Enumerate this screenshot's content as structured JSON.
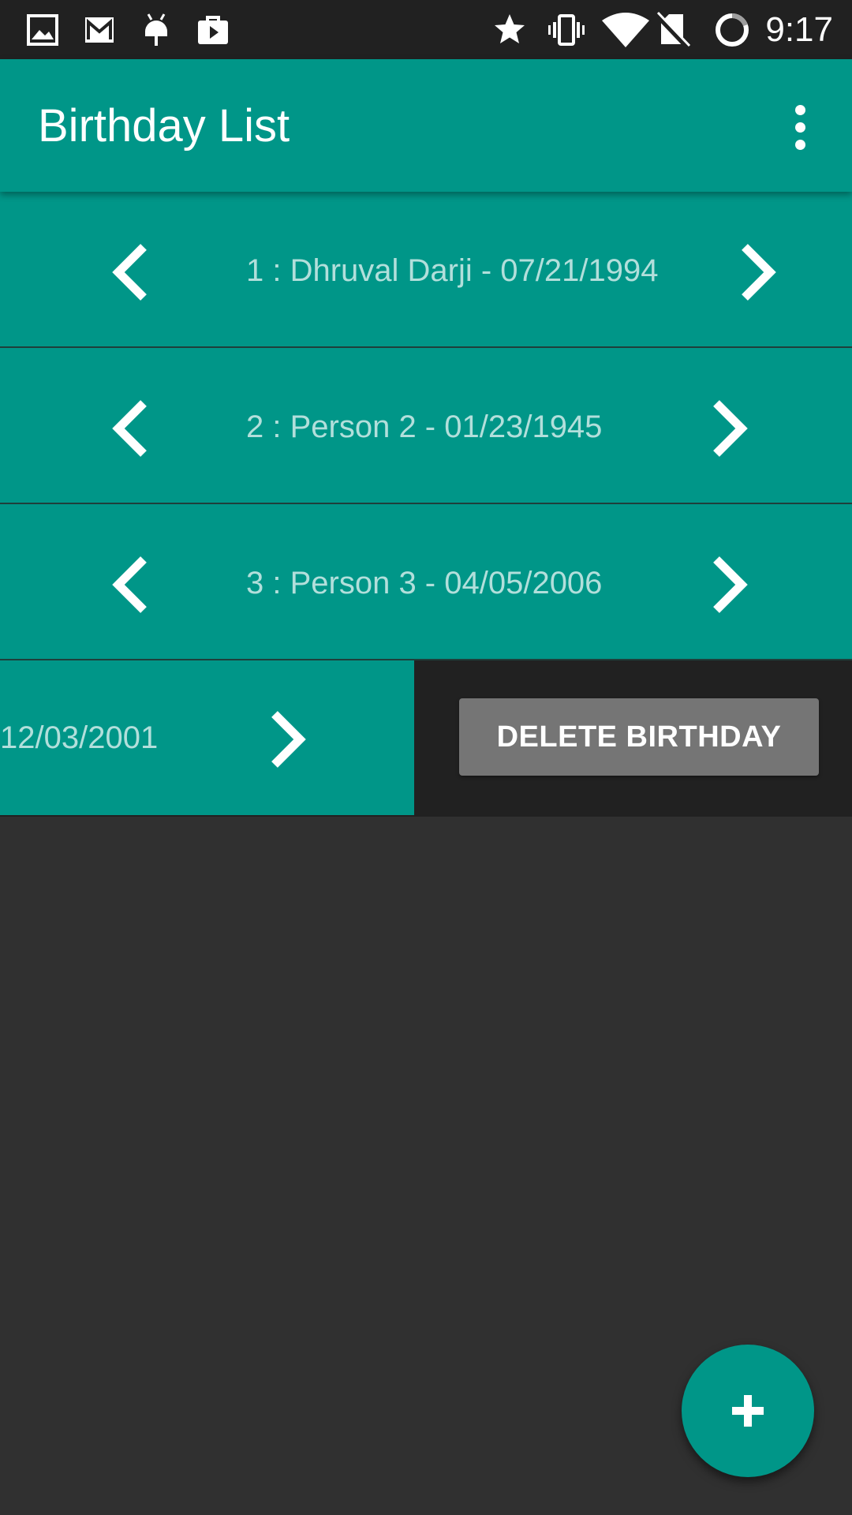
{
  "status_bar": {
    "time": "9:17",
    "left_icons": [
      "image-icon",
      "gmail-icon",
      "android-icon",
      "play-store-icon"
    ],
    "right_icons": [
      "star-icon",
      "vibrate-icon",
      "wifi-icon",
      "no-sim-icon",
      "battery-icon"
    ]
  },
  "app_bar": {
    "title": "Birthday List",
    "overflow_icon": "more-vert-icon"
  },
  "birthdays": [
    {
      "label": "1 : Dhruval Darji - 07/21/1994"
    },
    {
      "label": "2 : Person 2 - 01/23/1945"
    },
    {
      "label": "3 : Person 3 - 04/05/2006"
    }
  ],
  "swiped_item": {
    "visible_label": "12/03/2001",
    "delete_label": "DELETE BIRTHDAY"
  },
  "fab": {
    "icon": "add-icon"
  },
  "colors": {
    "primary": "#009688",
    "status_bar": "#212121",
    "background": "#303030",
    "item_text": "#b2dfdb",
    "delete_button": "#757575"
  }
}
